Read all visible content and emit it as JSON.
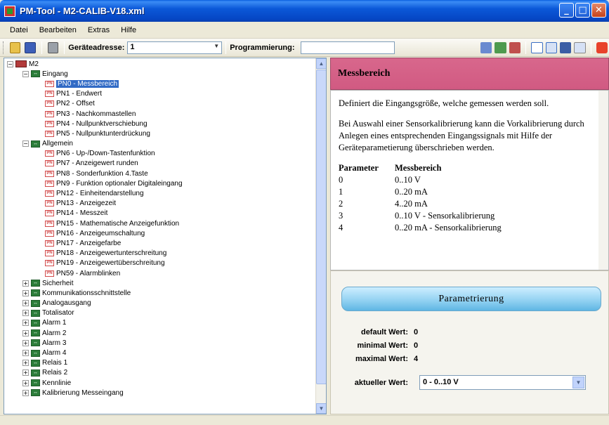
{
  "window": {
    "title": "PM-Tool - M2-CALIB-V18.xml"
  },
  "menu": [
    "Datei",
    "Bearbeiten",
    "Extras",
    "Hilfe"
  ],
  "toolbar": {
    "address_label": "Geräteadresse:",
    "address_value": "1",
    "programming_label": "Programmierung:",
    "programming_value": ""
  },
  "tree": [
    {
      "level": 0,
      "type": "root",
      "label": "M2",
      "expander": "−"
    },
    {
      "level": 1,
      "type": "folder",
      "label": "Eingang",
      "expander": "−"
    },
    {
      "level": 2,
      "type": "pn",
      "label": "PN0 - Messbereich",
      "selected": true
    },
    {
      "level": 2,
      "type": "pn",
      "label": "PN1 - Endwert"
    },
    {
      "level": 2,
      "type": "pn",
      "label": "PN2 - Offset"
    },
    {
      "level": 2,
      "type": "pn",
      "label": "PN3 - Nachkommastellen"
    },
    {
      "level": 2,
      "type": "pn",
      "label": "PN4 - Nullpunktverschiebung"
    },
    {
      "level": 2,
      "type": "pn",
      "label": "PN5 - Nullpunktunterdrückung"
    },
    {
      "level": 1,
      "type": "folder",
      "label": "Allgemein",
      "expander": "−"
    },
    {
      "level": 2,
      "type": "pn",
      "label": "PN6 - Up-/Down-Tastenfunktion"
    },
    {
      "level": 2,
      "type": "pn",
      "label": "PN7 - Anzeigewert runden"
    },
    {
      "level": 2,
      "type": "pn",
      "label": "PN8 - Sonderfunktion 4.Taste"
    },
    {
      "level": 2,
      "type": "pn",
      "label": "PN9 - Funktion optionaler Digitaleingang"
    },
    {
      "level": 2,
      "type": "pn",
      "label": "PN12 - Einheitendarstellung"
    },
    {
      "level": 2,
      "type": "pn",
      "label": "PN13 - Anzeigezeit"
    },
    {
      "level": 2,
      "type": "pn",
      "label": "PN14 - Messzeit"
    },
    {
      "level": 2,
      "type": "pn",
      "label": "PN15 - Mathematische Anzeigefunktion"
    },
    {
      "level": 2,
      "type": "pn",
      "label": "PN16 - Anzeigeumschaltung"
    },
    {
      "level": 2,
      "type": "pn",
      "label": "PN17 - Anzeigefarbe"
    },
    {
      "level": 2,
      "type": "pn",
      "label": "PN18 - Anzeigewertunterschreitung"
    },
    {
      "level": 2,
      "type": "pn",
      "label": "PN19 - Anzeigewertüberschreitung"
    },
    {
      "level": 2,
      "type": "pn",
      "label": "PN59 - Alarmblinken"
    },
    {
      "level": 1,
      "type": "folder",
      "label": "Sicherheit",
      "expander": "+"
    },
    {
      "level": 1,
      "type": "folder",
      "label": "Kommunikationsschnittstelle",
      "expander": "+"
    },
    {
      "level": 1,
      "type": "folder",
      "label": "Analogausgang",
      "expander": "+"
    },
    {
      "level": 1,
      "type": "folder",
      "label": "Totalisator",
      "expander": "+"
    },
    {
      "level": 1,
      "type": "folder",
      "label": "Alarm 1",
      "expander": "+"
    },
    {
      "level": 1,
      "type": "folder",
      "label": "Alarm 2",
      "expander": "+"
    },
    {
      "level": 1,
      "type": "folder",
      "label": "Alarm 3",
      "expander": "+"
    },
    {
      "level": 1,
      "type": "folder",
      "label": "Alarm 4",
      "expander": "+"
    },
    {
      "level": 1,
      "type": "folder",
      "label": "Relais 1",
      "expander": "+"
    },
    {
      "level": 1,
      "type": "folder",
      "label": "Relais 2",
      "expander": "+"
    },
    {
      "level": 1,
      "type": "folder",
      "label": "Kennlinie",
      "expander": "+"
    },
    {
      "level": 1,
      "type": "folder",
      "label": "Kalibrierung Messeingang",
      "expander": "+"
    }
  ],
  "detail": {
    "title": "Messbereich",
    "para1": "Definiert die Eingangsgröße, welche gemessen werden soll.",
    "para2": "Bei Auswahl einer Sensorkalibrierung kann die Vorkalibrierung durch Anlegen eines entsprechenden Eingangssignals mit Hilfe der Geräteparametierung überschrieben werden.",
    "table_headers": [
      "Parameter",
      "Messbereich"
    ],
    "table_rows": [
      [
        "0",
        "0..10 V"
      ],
      [
        "1",
        "0..20 mA"
      ],
      [
        "2",
        "4..20 mA"
      ],
      [
        "3",
        "0..10 V - Sensorkalibrierung"
      ],
      [
        "4",
        "0..20 mA - Sensorkalibrierung"
      ]
    ]
  },
  "param": {
    "button": "Parametrierung",
    "default_label": "default Wert:",
    "default_value": "0",
    "min_label": "minimal Wert:",
    "min_value": "0",
    "max_label": "maximal Wert:",
    "max_value": "4",
    "current_label": "aktueller Wert:",
    "current_value": "0 - 0..10 V"
  },
  "colors": {
    "header_pink": "#d15a82",
    "title_blue": "#0b58d8",
    "selection": "#316ac5"
  }
}
